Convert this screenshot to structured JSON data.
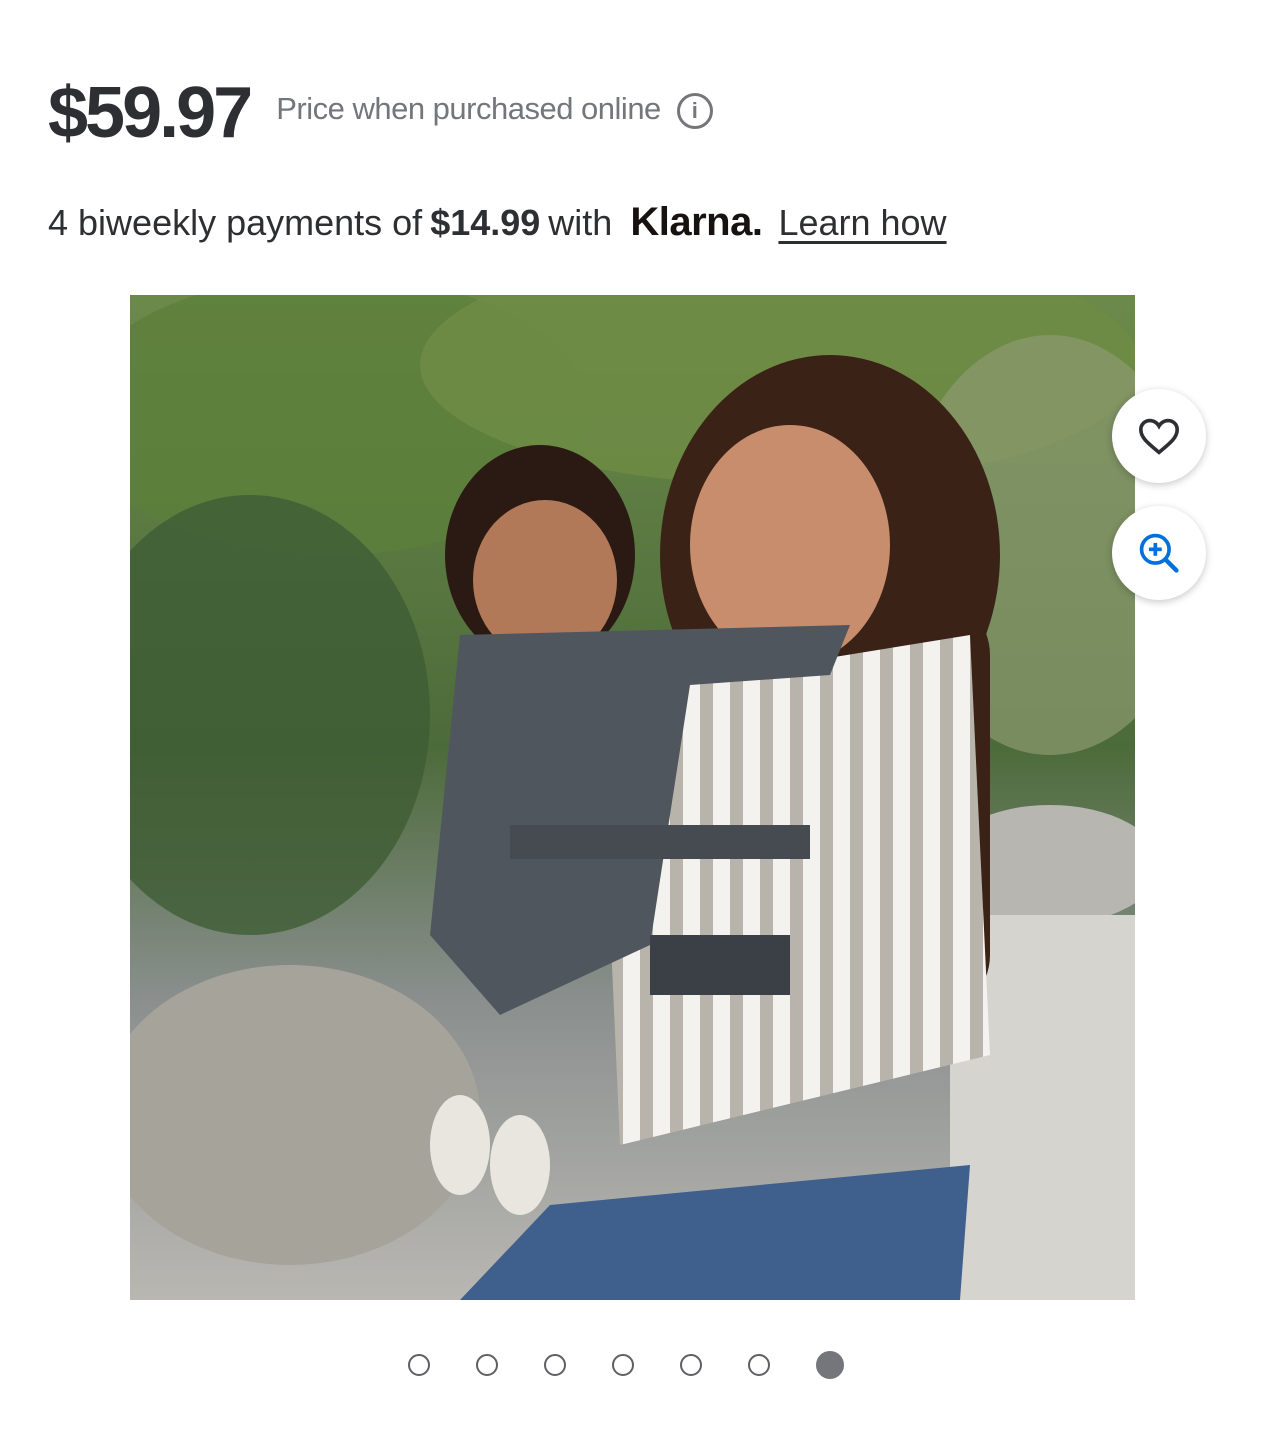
{
  "price": {
    "amount": "$59.97",
    "note": "Price when purchased online",
    "info_icon": "info-icon"
  },
  "klarna": {
    "prefix": "4 biweekly payments of",
    "amount": "$14.99",
    "with": "with",
    "brand": "Klarna.",
    "link": "Learn how"
  },
  "image": {
    "alt": "Woman carrying smiling toddler in grey star-print baby carrier outdoors"
  },
  "actions": {
    "favorite_icon": "heart-icon",
    "zoom_icon": "zoom-in-icon",
    "accent": "#0071dc"
  },
  "carousel": {
    "total": 7,
    "active_index": 7
  }
}
